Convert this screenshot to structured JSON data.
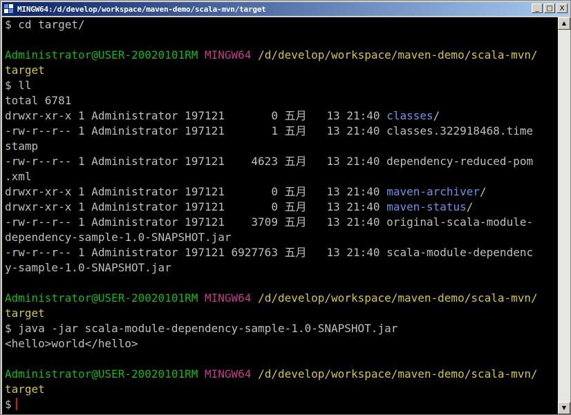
{
  "window": {
    "title": "MINGW64:/d/develop/workspace/maven-demo/scala-mvn/target",
    "controls": {
      "minimize": "_",
      "maximize": "□",
      "close": "X"
    }
  },
  "terminal": {
    "lines": [
      [
        {
          "text": "$ cd target/"
        }
      ],
      [
        {
          "text": ""
        }
      ],
      [
        {
          "text": "Administrator@USER-20020101RM",
          "color": "green"
        },
        {
          "text": " "
        },
        {
          "text": "MINGW64",
          "color": "magenta"
        },
        {
          "text": " "
        },
        {
          "text": "/d/develop/workspace/maven-demo/scala-mvn/",
          "color": "yellow"
        }
      ],
      [
        {
          "text": "target",
          "color": "yellow"
        }
      ],
      [
        {
          "text": "$ ll"
        }
      ],
      [
        {
          "text": "total 6781"
        }
      ],
      [
        {
          "text": "drwxr-xr-x 1 Administrator 197121       0 五月   13 21:40 "
        },
        {
          "text": "classes",
          "color": "blue"
        },
        {
          "text": "/"
        }
      ],
      [
        {
          "text": "-rw-r--r-- 1 Administrator 197121       1 五月   13 21:40 classes.322918468.time"
        }
      ],
      [
        {
          "text": "stamp"
        }
      ],
      [
        {
          "text": "-rw-r--r-- 1 Administrator 197121    4623 五月   13 21:40 dependency-reduced-pom"
        }
      ],
      [
        {
          "text": ".xml"
        }
      ],
      [
        {
          "text": "drwxr-xr-x 1 Administrator 197121       0 五月   13 21:40 "
        },
        {
          "text": "maven-archiver",
          "color": "blue"
        },
        {
          "text": "/"
        }
      ],
      [
        {
          "text": "drwxr-xr-x 1 Administrator 197121       0 五月   13 21:40 "
        },
        {
          "text": "maven-status",
          "color": "blue"
        },
        {
          "text": "/"
        }
      ],
      [
        {
          "text": "-rw-r--r-- 1 Administrator 197121    3709 五月   13 21:40 original-scala-module-"
        }
      ],
      [
        {
          "text": "dependency-sample-1.0-SNAPSHOT.jar"
        }
      ],
      [
        {
          "text": "-rw-r--r-- 1 Administrator 197121 6927763 五月   13 21:40 scala-module-dependenc"
        }
      ],
      [
        {
          "text": "y-sample-1.0-SNAPSHOT.jar"
        }
      ],
      [
        {
          "text": ""
        }
      ],
      [
        {
          "text": "Administrator@USER-20020101RM",
          "color": "green"
        },
        {
          "text": " "
        },
        {
          "text": "MINGW64",
          "color": "magenta"
        },
        {
          "text": " "
        },
        {
          "text": "/d/develop/workspace/maven-demo/scala-mvn/",
          "color": "yellow"
        }
      ],
      [
        {
          "text": "target",
          "color": "yellow"
        }
      ],
      [
        {
          "text": "$ java -jar scala-module-dependency-sample-1.0-SNAPSHOT.jar"
        }
      ],
      [
        {
          "text": "<hello>world</hello>"
        }
      ],
      [
        {
          "text": ""
        }
      ],
      [
        {
          "text": "Administrator@USER-20020101RM",
          "color": "green"
        },
        {
          "text": " "
        },
        {
          "text": "MINGW64",
          "color": "magenta"
        },
        {
          "text": " "
        },
        {
          "text": "/d/develop/workspace/maven-demo/scala-mvn/",
          "color": "yellow"
        }
      ],
      [
        {
          "text": "target",
          "color": "yellow"
        }
      ],
      [
        {
          "text": "$"
        }
      ]
    ]
  },
  "scrollbar": {
    "up_icon": "▲",
    "down_icon": "▼"
  },
  "colors": {
    "background": "#000000",
    "text": "#bfbfbf",
    "user_host": "#11b911",
    "mingw": "#c33c8c",
    "path": "#d5c73a",
    "directory": "#6b93e8",
    "cursor": "#d01818"
  }
}
